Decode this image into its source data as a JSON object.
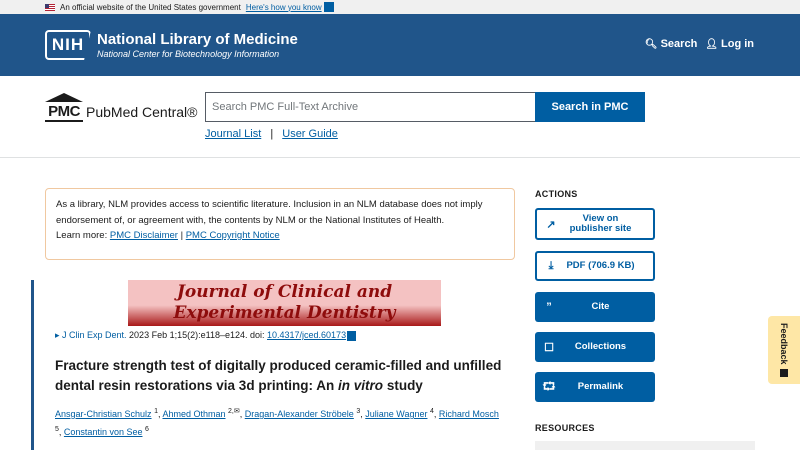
{
  "gov_banner": {
    "text": "An official website of the United States government",
    "link": "Here's how you know"
  },
  "nih": {
    "badge": "NIH",
    "title": "National Library of Medicine",
    "subtitle": "National Center for Biotechnology Information",
    "search_label": "Search",
    "login_label": "Log in"
  },
  "pmc": {
    "logo_mark": "PMC",
    "logo_name": "PubMed Central®",
    "search_placeholder": "Search PMC Full-Text Archive",
    "search_button": "Search in PMC",
    "links": [
      "Journal List",
      "User Guide"
    ],
    "separator": "|"
  },
  "disclaimer": {
    "text": "As a library, NLM provides access to scientific literature. Inclusion in an NLM database does not imply endorsement of, or agreement with, the contents by NLM or the National Institutes of Health.",
    "learn_more": "Learn more:",
    "link1": "PMC Disclaimer",
    "sep": "|",
    "link2": "PMC Copyright Notice"
  },
  "article": {
    "journal_banner_line1": "Journal of Clinical and",
    "journal_banner_line2": "Experimental Dentistry",
    "journal_link": "▸ J Clin Exp Dent.",
    "citation_text": " 2023 Feb 1;15(2):e118–e124. doi: ",
    "doi": "10.4317/jced.60173",
    "title_main": "Fracture strength test of digitally produced ceramic-filled and unfilled dental resin restorations via 3d printing: An ",
    "title_italic": "in vitro",
    "title_end": " study",
    "authors": [
      {
        "name": "Ansgar-Christian Schulz",
        "sup": "1"
      },
      {
        "name": "Ahmed Othman",
        "sup": "2,✉"
      },
      {
        "name": "Dragan-Alexander Ströbele",
        "sup": "3"
      },
      {
        "name": "Juliane Wagner",
        "sup": "4"
      },
      {
        "name": "Richard Mosch",
        "sup": "5"
      },
      {
        "name": "Constantin von See",
        "sup": "6"
      }
    ]
  },
  "actions": {
    "heading": "ACTIONS",
    "buttons": [
      {
        "label": "View on publisher site",
        "icon": "external-link-icon"
      },
      {
        "label": "PDF (706.9 KB)",
        "icon": "download-icon"
      },
      {
        "label": "Cite",
        "icon": "quote-icon"
      },
      {
        "label": "Collections",
        "icon": "bookmark-icon"
      },
      {
        "label": "Permalink",
        "icon": "share-icon"
      }
    ]
  },
  "resources": {
    "heading": "RESOURCES"
  },
  "feedback": {
    "label": "Feedback"
  },
  "colors": {
    "nih_blue": "#20558a",
    "link_blue": "#005ea2",
    "banner_red": "#8e0c0c",
    "feedback_yellow": "#fee7a6"
  }
}
